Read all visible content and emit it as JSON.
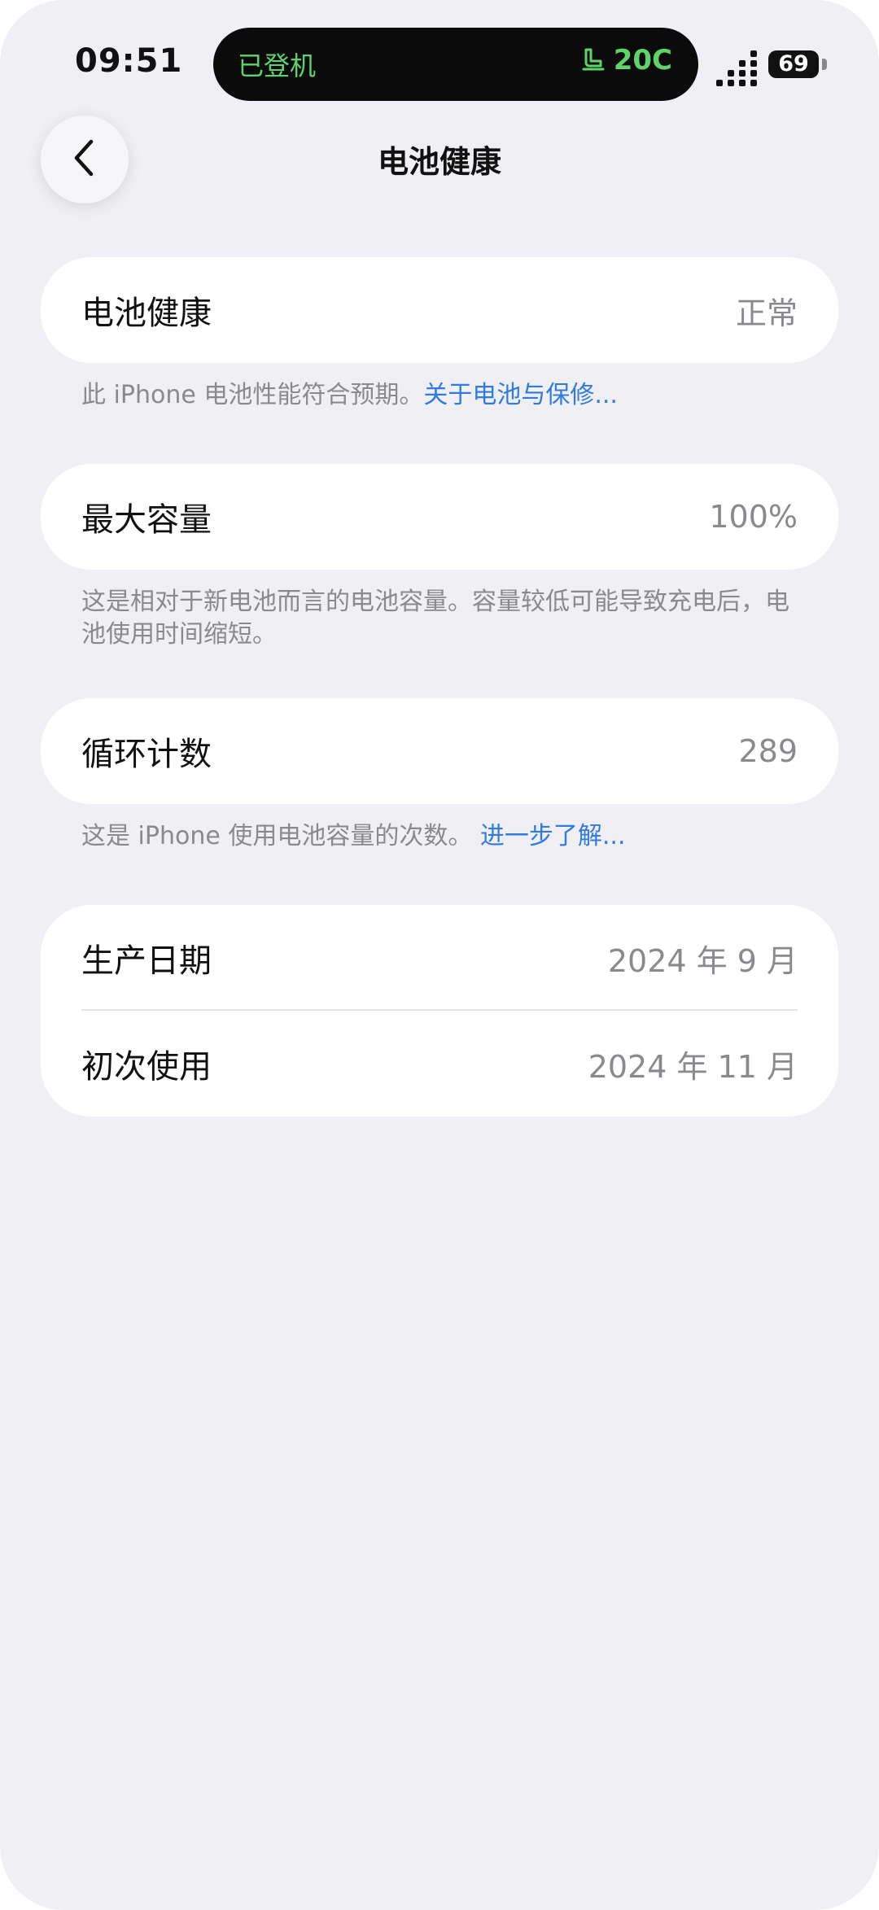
{
  "status_bar": {
    "time": "09:51",
    "island_left": "已登机",
    "island_right": "20C",
    "battery": "69"
  },
  "nav": {
    "title": "电池健康"
  },
  "sections": {
    "health": {
      "label": "电池健康",
      "value": "正常",
      "footnote_text": "此 iPhone 电池性能符合预期。",
      "footnote_link": "关于电池与保修..."
    },
    "capacity": {
      "label": "最大容量",
      "value": "100%",
      "footnote_text": "这是相对于新电池而言的电池容量。容量较低可能导致充电后，电池使用时间缩短。"
    },
    "cycles": {
      "label": "循环计数",
      "value": "289",
      "footnote_text": "这是 iPhone 使用电池容量的次数。",
      "footnote_link": "进一步了解..."
    },
    "dates": {
      "manufacture_label": "生产日期",
      "manufacture_value": "2024 年 9 月",
      "first_use_label": "初次使用",
      "first_use_value": "2024 年 11 月"
    }
  },
  "colors": {
    "background": "#efeff4",
    "card": "#ffffff",
    "link": "#2f7be0",
    "island_text": "#5fd36a",
    "secondary_text": "#8a8a8e"
  },
  "icons": {
    "back": "chevron-left-icon",
    "seat": "seat-icon",
    "signal": "signal-icon",
    "battery": "battery-icon"
  }
}
